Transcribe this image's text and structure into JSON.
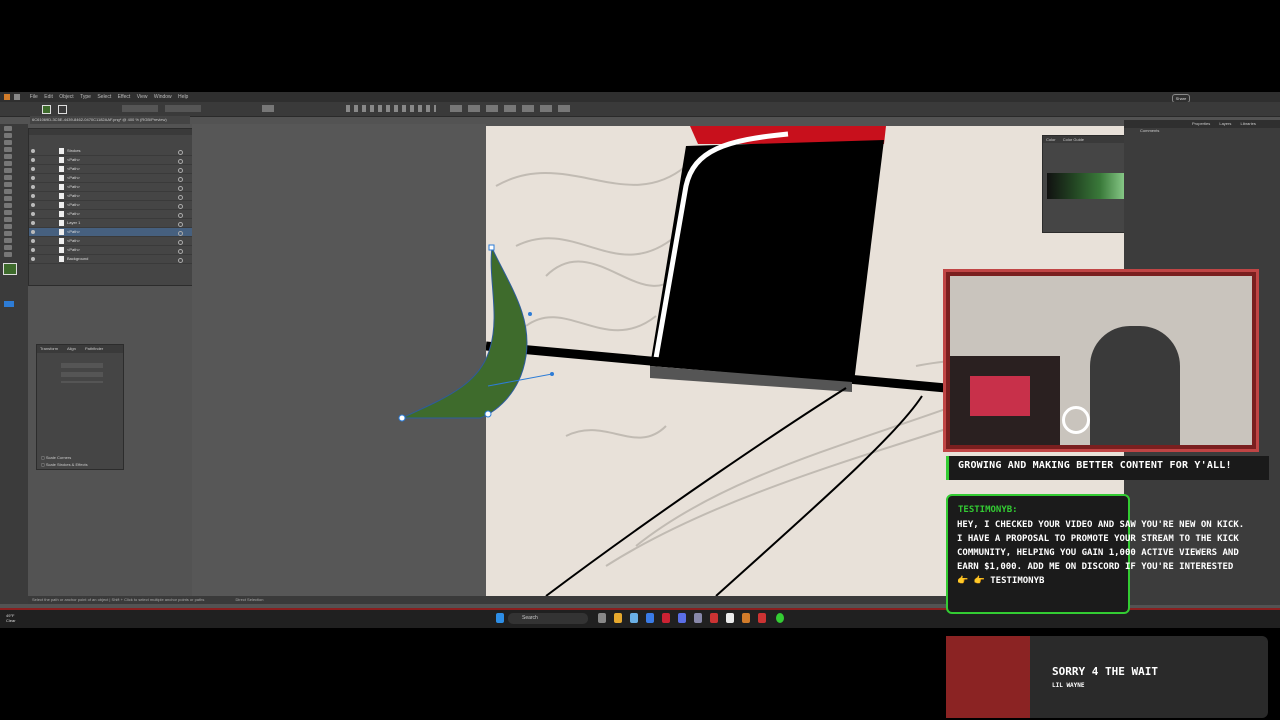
{
  "app": {
    "menu": [
      "File",
      "Edit",
      "Object",
      "Type",
      "Select",
      "Effect",
      "View",
      "Window",
      "Help"
    ],
    "doc_tab": "6C61069D-3C5E-4439-8462-0470C1182AAF.png* @ 400 % (RGB/Preview)",
    "share_label": "Share",
    "status_hint": "Select the path or anchor point of an object | Shift + Click to select multiple anchor points or paths",
    "status_tool": "Direct Selection"
  },
  "layers": {
    "items": [
      {
        "label": "Strokes",
        "selected": false
      },
      {
        "label": "<Path>",
        "selected": false
      },
      {
        "label": "<Path>",
        "selected": false
      },
      {
        "label": "<Path>",
        "selected": false
      },
      {
        "label": "<Path>",
        "selected": false
      },
      {
        "label": "<Path>",
        "selected": false
      },
      {
        "label": "<Path>",
        "selected": false
      },
      {
        "label": "<Path>",
        "selected": false
      },
      {
        "label": "Layer 1",
        "selected": false
      },
      {
        "label": "<Path>",
        "selected": true
      },
      {
        "label": "<Path>",
        "selected": false
      },
      {
        "label": "<Path>",
        "selected": false
      },
      {
        "label": "Background",
        "selected": false
      }
    ]
  },
  "transform": {
    "tabs": [
      "Transform",
      "Align",
      "Pathfinder"
    ],
    "scale_corners": "Scale Corners",
    "scale_strokes": "Scale Strokes & Effects"
  },
  "swatch_panel": {
    "tabs": [
      "Color",
      "Color Guide"
    ]
  },
  "right_panel": {
    "tabs": [
      "Properties",
      "Layers",
      "Libraries"
    ],
    "comments": "Comments"
  },
  "taskbar": {
    "search": "Search",
    "weather_temp": "49°F",
    "weather_desc": "Clear"
  },
  "stream": {
    "banner": "GROWING AND MAKING BETTER CONTENT FOR Y'ALL!",
    "chat_user": "TESTIMONYB:",
    "chat_message": "HEY, I CHECKED YOUR VIDEO AND SAW YOU'RE NEW ON KICK. I HAVE A PROPOSAL TO PROMOTE YOUR STREAM TO THE KICK COMMUNITY, HELPING YOU GAIN 1,000 ACTIVE VIEWERS AND EARN $1,000. ADD ME ON DISCORD IF YOU'RE INTERESTED 👉 👉 TESTIMONYB",
    "song_title": "SORRY 4 THE WAIT",
    "song_artist": "LIL WAYNE"
  },
  "colors": {
    "shape_green": "#3e6b2c",
    "accent_green": "#33cc33",
    "frame_red": "#c04545",
    "artboard": "#e8e1d9"
  }
}
